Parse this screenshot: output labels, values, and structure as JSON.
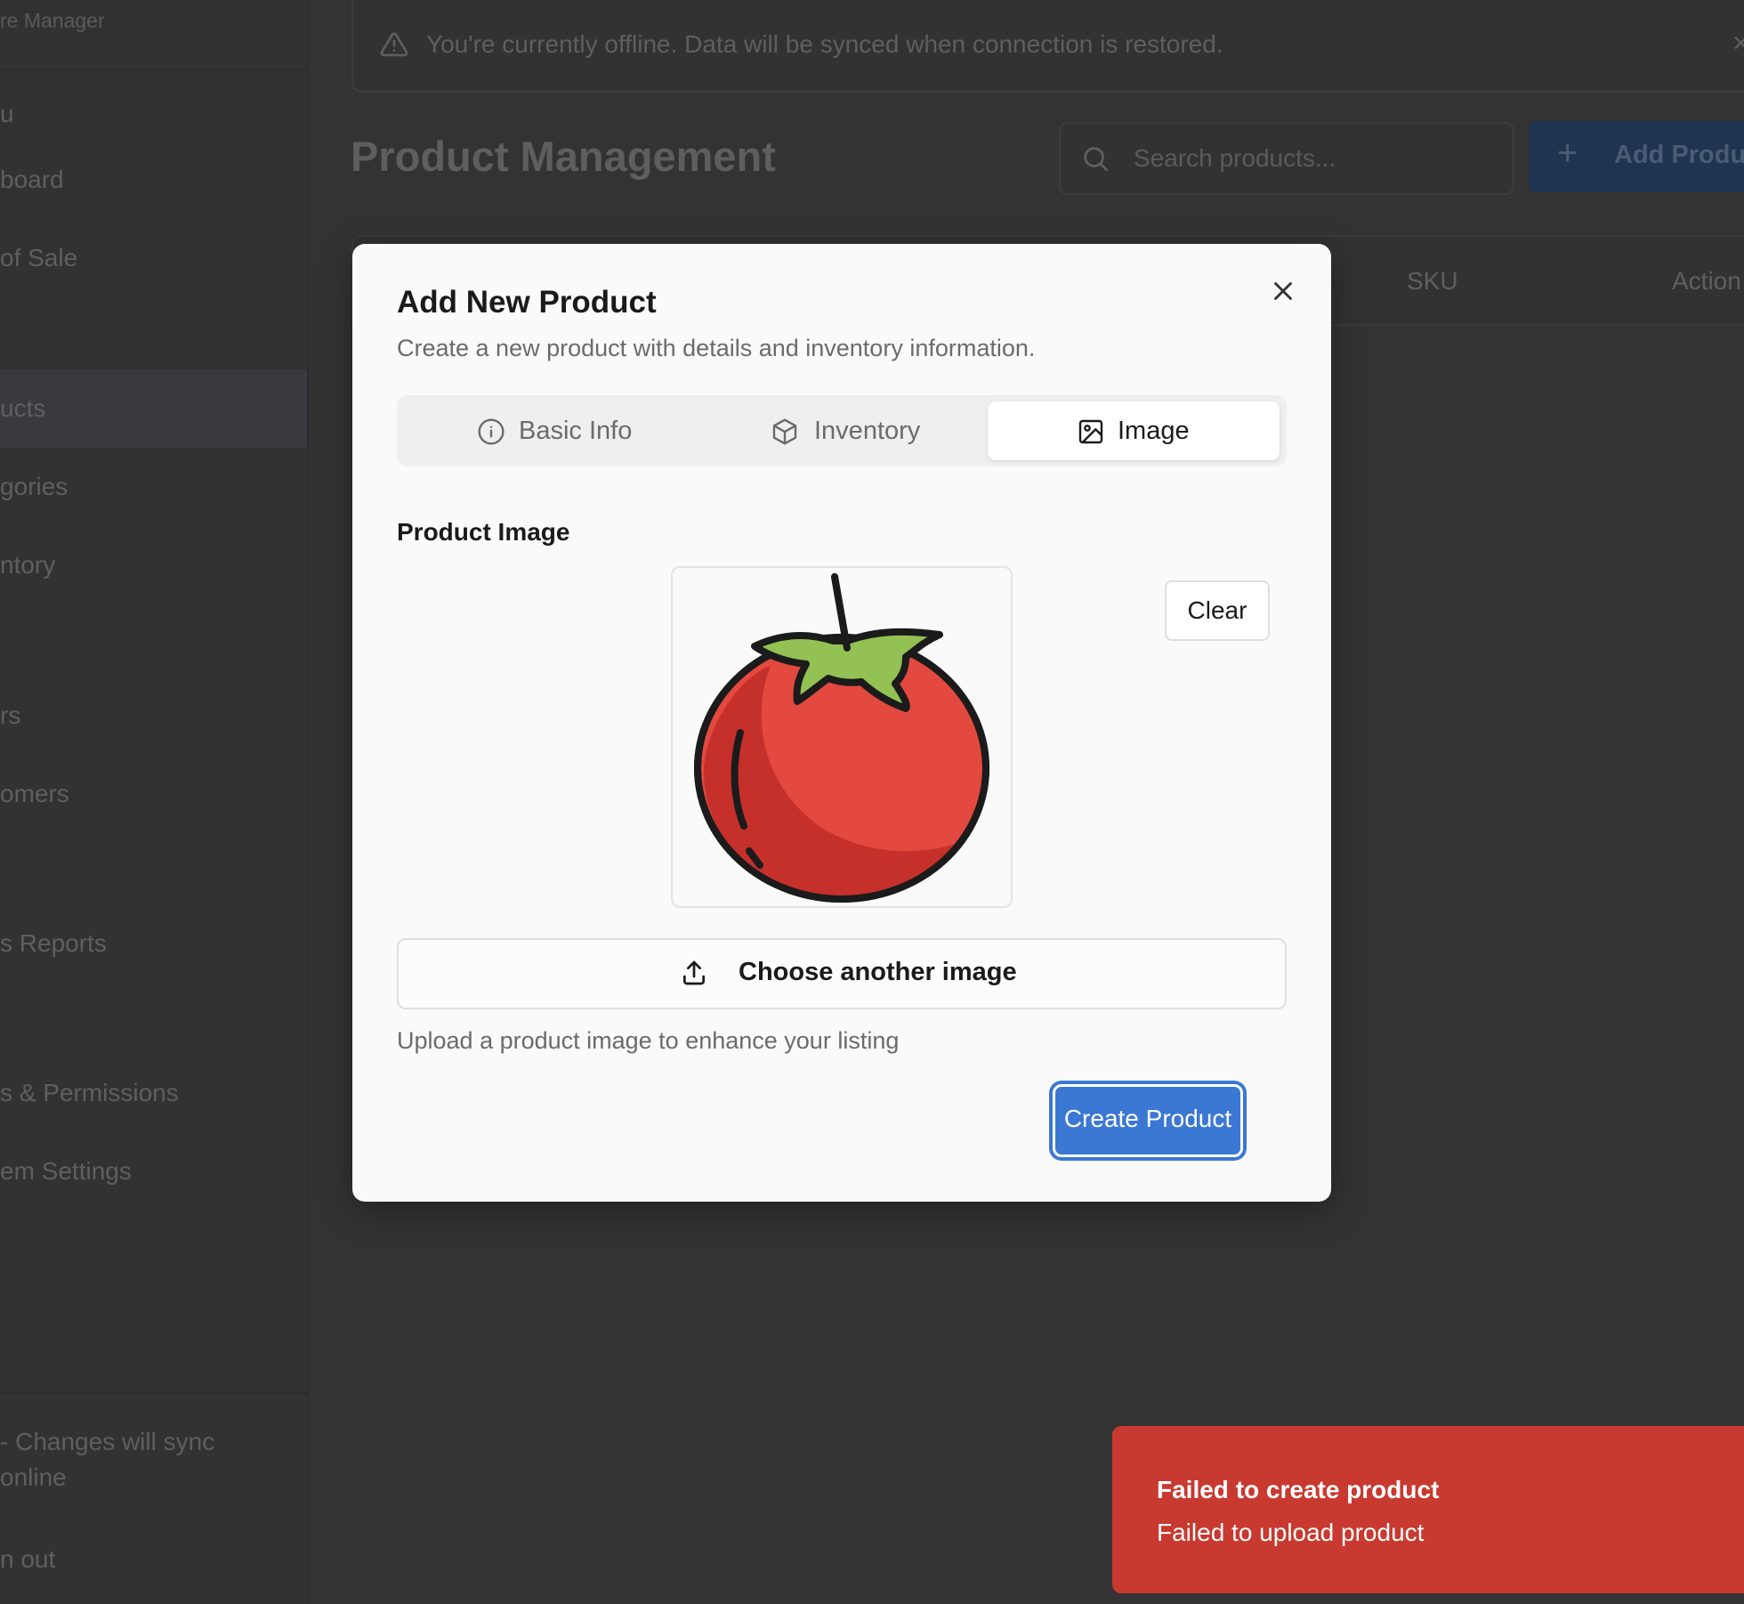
{
  "sidebar": {
    "brand": "re Manager",
    "section_label": "u",
    "items": [
      {
        "label": "board"
      },
      {
        "label": "of Sale"
      },
      {
        "label": "ucts"
      },
      {
        "label": "gories"
      },
      {
        "label": "ntory"
      },
      {
        "label": "rs"
      },
      {
        "label": "omers"
      },
      {
        "label": "s Reports"
      },
      {
        "label": "s & Permissions"
      },
      {
        "label": "em Settings"
      }
    ],
    "offline_note_line1": " - Changes will sync",
    "offline_note_line2": "online",
    "sign_out": "n out"
  },
  "banner": {
    "icon": "warning-triangle-icon",
    "text": "You're currently offline. Data will be synced when connection is restored.",
    "close_symbol": "×"
  },
  "header": {
    "title": "Product Management",
    "search_placeholder": "Search products...",
    "add_button_symbol": "+",
    "add_button_label": "Add Produc"
  },
  "table": {
    "columns": [
      "SKU",
      "Action"
    ]
  },
  "modal": {
    "title": "Add New Product",
    "description": "Create a new product with details and inventory information.",
    "tabs": [
      {
        "label": "Basic Info",
        "icon": "info-icon",
        "active": false
      },
      {
        "label": "Inventory",
        "icon": "box-icon",
        "active": false
      },
      {
        "label": "Image",
        "icon": "image-icon",
        "active": true
      }
    ],
    "image_section": {
      "label": "Product Image",
      "preview_icon": "tomato-image",
      "clear_label": "Clear",
      "upload_label": "Choose another image",
      "help_text": "Upload a product image to enhance your listing"
    },
    "submit_label": "Create Product"
  },
  "toast": {
    "title": "Failed to create product",
    "message": "Failed to upload product",
    "color": "#c8392f"
  },
  "colors": {
    "primary": "#3b78d4",
    "overlay": "#333333"
  }
}
